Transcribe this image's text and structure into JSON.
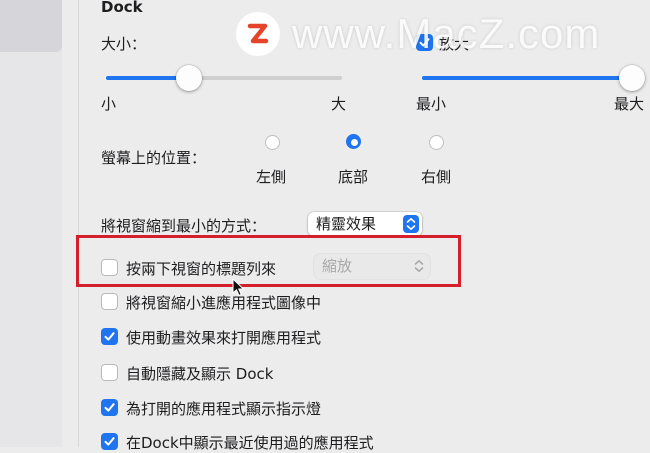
{
  "section_title": "Dock",
  "size": {
    "label": "大小：",
    "min_label": "小",
    "max_label": "大",
    "value": 0.35
  },
  "magnification": {
    "label": "放大",
    "checked": true,
    "min_label": "最小",
    "max_label": "最大",
    "value": 1.0
  },
  "position": {
    "label": "螢幕上的位置：",
    "options": [
      "左側",
      "底部",
      "右側"
    ],
    "selected": "底部"
  },
  "minimize_effect": {
    "label": "將視窗縮到最小的方式：",
    "value": "精靈效果"
  },
  "double_click_title": {
    "label": "按兩下視窗的標題列來",
    "checked": false,
    "value": "縮放",
    "enabled": false
  },
  "checkboxes": [
    {
      "label": "將視窗縮小進應用程式圖像中",
      "checked": false
    },
    {
      "label": "使用動畫效果來打開應用程式",
      "checked": true
    },
    {
      "label": "自動隱藏及顯示 Dock",
      "checked": false
    },
    {
      "label": "為打開的應用程式顯示指示燈",
      "checked": true
    },
    {
      "label": "在Dock中顯示最近使用過的應用程式",
      "checked": true
    }
  ],
  "watermark": {
    "text": "www.MacZ.com"
  },
  "colors": {
    "accent": "#1f74ef",
    "highlight_box": "#d4202a",
    "background": "#ececec"
  }
}
